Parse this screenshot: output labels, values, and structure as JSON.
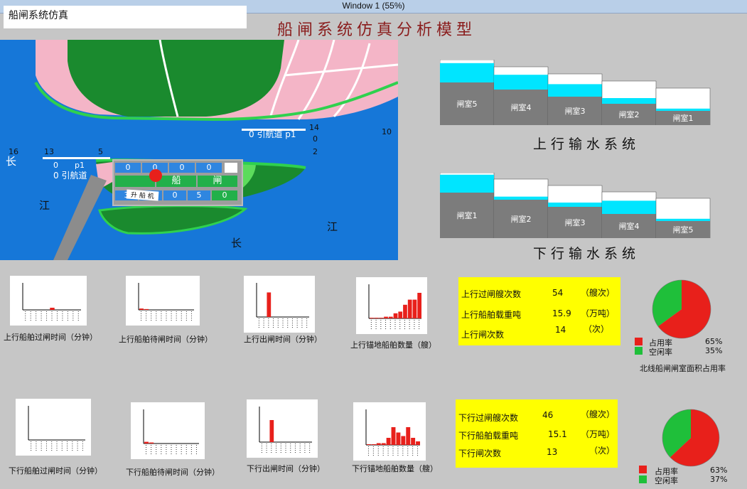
{
  "window": {
    "title": "Window 1 (55%)"
  },
  "app": {
    "name": "船闸系统仿真",
    "main_title": "船闸系统仿真分析模型"
  },
  "map": {
    "lock_top": [
      "0",
      "0",
      "0",
      "0"
    ],
    "lock_mid": [
      "船",
      "闸"
    ],
    "lock_bot": [
      "3",
      "0",
      "0",
      "5",
      "0"
    ],
    "upper_approach": "0 引航道 p1",
    "lower_approach": "0 引航道",
    "upper_label_p1": "p1",
    "lower_p1": "p1",
    "right_num_14": "14",
    "right_num_0": "0",
    "right_num_2": "2",
    "right_num_10": "10",
    "left_num_16": "16",
    "left_num_13": "13",
    "left_num_5": "5",
    "left_num_0": "0",
    "river_chang_left": "长",
    "river_jiang_left": "江",
    "river_jiang_right": "江",
    "river_chang_bottom": "长",
    "shipyard": "升 船 机"
  },
  "upstream": {
    "title": "上行输水系统",
    "chambers": [
      "闸室5",
      "闸室4",
      "闸室3",
      "闸室2",
      "闸室1"
    ],
    "levels": [
      0.85,
      0.65,
      0.55,
      0.25,
      0.1
    ]
  },
  "downstream": {
    "title": "下行输水系统",
    "chambers": [
      "闸室1",
      "闸室2",
      "闸室3",
      "闸室4",
      "闸室5"
    ],
    "levels": [
      0.9,
      0.15,
      0.2,
      0.6,
      0.1
    ]
  },
  "charts_up": [
    {
      "caption": "上行船舶过闸时间（分钟）",
      "bars": [
        0,
        0,
        0,
        0,
        0,
        0.08,
        0,
        0,
        0,
        0,
        0
      ]
    },
    {
      "caption": "上行船舶待闸时间（分钟）",
      "bars": [
        0.05,
        0.03,
        0,
        0,
        0,
        0,
        0,
        0,
        0,
        0,
        0
      ]
    },
    {
      "caption": "上行出闸时间（分钟）",
      "bars": [
        0,
        0,
        0.72,
        0,
        0,
        0,
        0,
        0,
        0,
        0,
        0
      ]
    },
    {
      "caption": "上行锚地船舶数量（艘）",
      "bars": [
        0.02,
        0.02,
        0.02,
        0.05,
        0.05,
        0.15,
        0.2,
        0.4,
        0.55,
        0.55,
        0.75
      ]
    }
  ],
  "charts_down": [
    {
      "caption": "下行船舶过闸时间（分钟）",
      "bars": [
        0,
        0,
        0,
        0,
        0,
        0,
        0,
        0,
        0,
        0,
        0
      ]
    },
    {
      "caption": "下行船舶待闸时间（分钟）",
      "bars": [
        0.05,
        0.03,
        0,
        0,
        0,
        0,
        0,
        0,
        0,
        0,
        0
      ]
    },
    {
      "caption": "下行出闸时间（分钟）",
      "bars": [
        0,
        0,
        0.62,
        0,
        0,
        0,
        0,
        0,
        0,
        0,
        0
      ]
    },
    {
      "caption": "下行锚地船舶数量（艘）",
      "bars": [
        0.02,
        0.02,
        0.05,
        0.05,
        0.2,
        0.5,
        0.35,
        0.25,
        0.5,
        0.2,
        0.1
      ]
    }
  ],
  "stats_up": {
    "rows": [
      {
        "label": "上行过闸艘次数",
        "value": "54",
        "unit": "（艘次）"
      },
      {
        "label": "上行船舶载重吨",
        "value": "15.9",
        "unit": "（万吨）"
      },
      {
        "label": "上行闸次数",
        "value": "14",
        "unit": "（次）"
      }
    ]
  },
  "stats_down": {
    "rows": [
      {
        "label": "下行过闸艘次数",
        "value": "46",
        "unit": "（艘次）"
      },
      {
        "label": "下行船舶载重吨",
        "value": "15.1",
        "unit": "（万吨）"
      },
      {
        "label": "下行闸次数",
        "value": "13",
        "unit": "（次）"
      }
    ]
  },
  "pie_up": {
    "occupied_label": "占用率",
    "occupied_value": "65%",
    "occupied": 0.65,
    "idle_label": "空闲率",
    "idle_value": "35%",
    "caption": "北线船闸闸室面积占用率",
    "colors": {
      "occupied": "#e8201b",
      "idle": "#1fbf3a"
    }
  },
  "pie_down": {
    "occupied_label": "占用率",
    "occupied_value": "63%",
    "occupied": 0.63,
    "idle_label": "空闲率",
    "idle_value": "37%",
    "colors": {
      "occupied": "#e8201b",
      "idle": "#1fbf3a"
    }
  }
}
